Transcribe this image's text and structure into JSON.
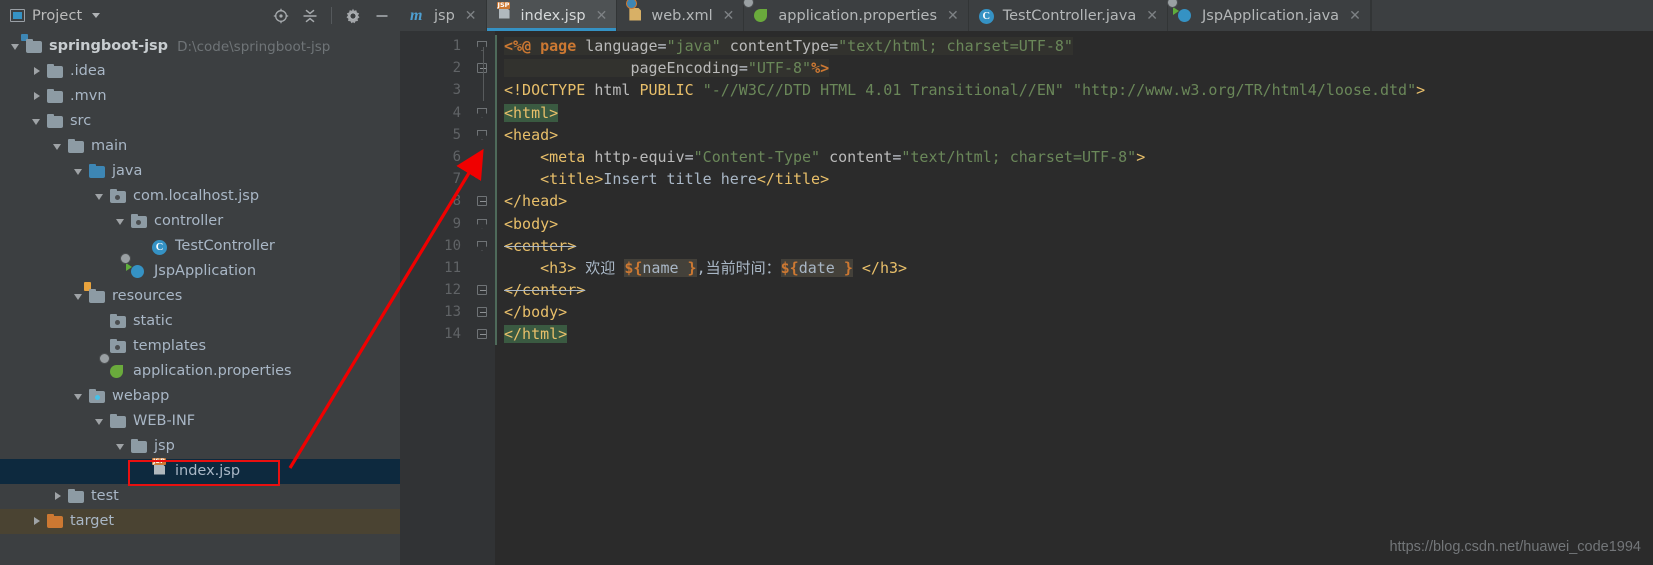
{
  "panel": {
    "title": "Project",
    "icon": "project-icon",
    "tools": [
      {
        "name": "locate-icon",
        "glyph": "locate"
      },
      {
        "name": "collapse-all-icon",
        "glyph": "collapse"
      },
      {
        "name": "settings-gear-icon",
        "glyph": "gear"
      },
      {
        "name": "hide-panel-icon",
        "glyph": "minus"
      }
    ]
  },
  "tree": [
    {
      "label": "springboot-jsp",
      "sub": "D:\\code\\springboot-jsp",
      "indent": 0,
      "twisty": "open",
      "icon": "module-folder-icon",
      "bold": true,
      "state": "normal"
    },
    {
      "label": ".idea",
      "sub": "",
      "indent": 1,
      "twisty": "closed",
      "icon": "folder-icon",
      "bold": false,
      "state": "normal"
    },
    {
      "label": ".mvn",
      "sub": "",
      "indent": 1,
      "twisty": "closed",
      "icon": "folder-icon",
      "bold": false,
      "state": "normal"
    },
    {
      "label": "src",
      "sub": "",
      "indent": 1,
      "twisty": "open",
      "icon": "folder-icon",
      "bold": false,
      "state": "normal"
    },
    {
      "label": "main",
      "sub": "",
      "indent": 2,
      "twisty": "open",
      "icon": "folder-icon",
      "bold": false,
      "state": "normal"
    },
    {
      "label": "java",
      "sub": "",
      "indent": 3,
      "twisty": "open",
      "icon": "source-folder-icon",
      "bold": false,
      "state": "normal"
    },
    {
      "label": "com.localhost.jsp",
      "sub": "",
      "indent": 4,
      "twisty": "open",
      "icon": "package-icon",
      "bold": false,
      "state": "normal"
    },
    {
      "label": "controller",
      "sub": "",
      "indent": 5,
      "twisty": "open",
      "icon": "package-icon",
      "bold": false,
      "state": "normal"
    },
    {
      "label": "TestController",
      "sub": "",
      "indent": 6,
      "twisty": "none",
      "icon": "java-class-icon",
      "bold": false,
      "state": "normal"
    },
    {
      "label": "JspApplication",
      "sub": "",
      "indent": 5,
      "twisty": "none",
      "icon": "spring-boot-class-icon",
      "bold": false,
      "state": "normal"
    },
    {
      "label": "resources",
      "sub": "",
      "indent": 3,
      "twisty": "open",
      "icon": "resources-folder-icon",
      "bold": false,
      "state": "normal"
    },
    {
      "label": "static",
      "sub": "",
      "indent": 4,
      "twisty": "none",
      "icon": "package-icon",
      "bold": false,
      "state": "normal"
    },
    {
      "label": "templates",
      "sub": "",
      "indent": 4,
      "twisty": "none",
      "icon": "package-icon",
      "bold": false,
      "state": "normal"
    },
    {
      "label": "application.properties",
      "sub": "",
      "indent": 4,
      "twisty": "none",
      "icon": "spring-properties-icon",
      "bold": false,
      "state": "normal"
    },
    {
      "label": "webapp",
      "sub": "",
      "indent": 3,
      "twisty": "open",
      "icon": "web-folder-icon",
      "bold": false,
      "state": "normal"
    },
    {
      "label": "WEB-INF",
      "sub": "",
      "indent": 4,
      "twisty": "open",
      "icon": "folder-icon",
      "bold": false,
      "state": "normal"
    },
    {
      "label": "jsp",
      "sub": "",
      "indent": 5,
      "twisty": "open",
      "icon": "folder-icon",
      "bold": false,
      "state": "normal"
    },
    {
      "label": "index.jsp",
      "sub": "",
      "indent": 6,
      "twisty": "none",
      "icon": "jsp-file-icon",
      "bold": false,
      "state": "selected"
    },
    {
      "label": "test",
      "sub": "",
      "indent": 2,
      "twisty": "closed",
      "icon": "folder-icon",
      "bold": false,
      "state": "normal"
    },
    {
      "label": "target",
      "sub": "",
      "indent": 1,
      "twisty": "closed",
      "icon": "target-folder-icon",
      "bold": false,
      "state": "excluded"
    }
  ],
  "tabs": [
    {
      "label": "jsp",
      "icon": "maven-module-icon",
      "active": false
    },
    {
      "label": "index.jsp",
      "icon": "jsp-file-icon",
      "active": true
    },
    {
      "label": "web.xml",
      "icon": "web-xml-icon",
      "active": false
    },
    {
      "label": "application.properties",
      "icon": "spring-properties-icon",
      "active": false
    },
    {
      "label": "TestController.java",
      "icon": "java-class-icon",
      "active": false
    },
    {
      "label": "JspApplication.java",
      "icon": "spring-boot-class-icon",
      "active": false
    }
  ],
  "editor": {
    "line_numbers": [
      "1",
      "2",
      "3",
      "4",
      "5",
      "6",
      "7",
      "8",
      "9",
      "10",
      "11",
      "12",
      "13",
      "14"
    ],
    "lines": [
      "<%@ page language=\"java\" contentType=\"text/html; charset=UTF-8\"",
      "              pageEncoding=\"UTF-8\"%>",
      "<!DOCTYPE html PUBLIC \"-//W3C//DTD HTML 4.01 Transitional//EN\" \"http://www.w3.org/TR/html4/loose.dtd\">",
      "<html>",
      "<head>",
      "    <meta http-equiv=\"Content-Type\" content=\"text/html; charset=UTF-8\">",
      "    <title>Insert title here</title>",
      "</head>",
      "<body>",
      "<center>",
      "    <h3> 欢迎 ${name },当前时间：${date } </h3>",
      "</center>",
      "</body>",
      "</html>"
    ]
  },
  "watermark": "https://blog.csdn.net/huawei_code1994",
  "colors": {
    "accent": "#3592c4",
    "panel_bg": "#3c3f41",
    "editor_bg": "#2b2b2b",
    "gutter_bg": "#313335",
    "selection": "#0d293e",
    "highlight_box": "#e81010",
    "arrow": "#f00000",
    "excluded_row": "#4a4332"
  }
}
